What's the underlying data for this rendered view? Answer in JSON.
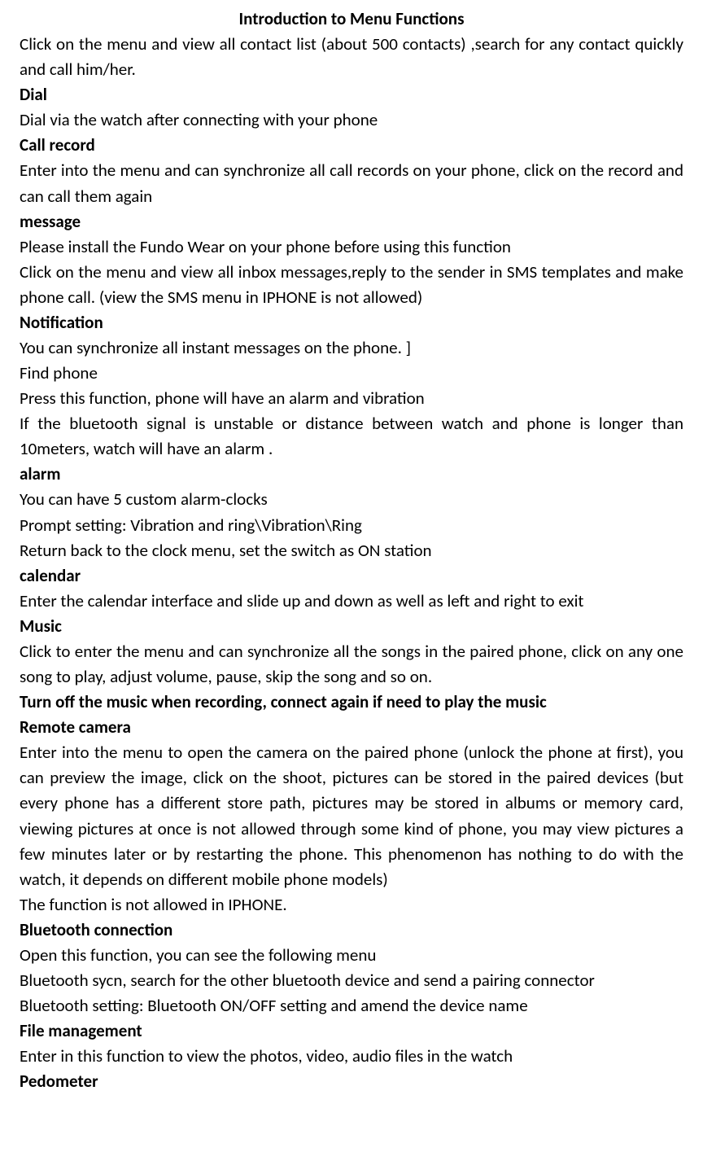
{
  "title": "Introduction to Menu Functions",
  "intro": "Click on the menu and view all contact list (about 500 contacts) ,search for any contact quickly and call him/her.",
  "sections": {
    "dial": {
      "heading": "Dial",
      "body": "Dial via the watch after connecting with your phone"
    },
    "call_record": {
      "heading": "Call record",
      "body": "Enter into the menu and can synchronize all call records on your phone, click on the record and can call them again"
    },
    "message": {
      "heading": "message",
      "body1": "Please install the Fundo Wear on your phone before using this function",
      "body2": "Click on the menu and view all inbox messages,reply to the sender in SMS templates and make phone call. (view the SMS menu in IPHONE is not allowed)"
    },
    "notification": {
      "heading": "Notification",
      "body1": "You can synchronize all instant messages on the phone. ]",
      "body2": "Find phone",
      "body3": "Press this function, phone will have an alarm and vibration",
      "body4": "If the bluetooth signal is unstable or distance between watch and phone is longer than 10meters, watch will have an alarm ."
    },
    "alarm": {
      "heading": "alarm",
      "body1": "You can have 5 custom alarm-clocks",
      "body2": "Prompt setting: Vibration and ring\\Vibration\\Ring",
      "body3": "Return back to the clock menu, set the switch as ON station"
    },
    "calendar": {
      "heading": "calendar",
      "body": "Enter the calendar interface and slide up and down as well as left and right to exit"
    },
    "music": {
      "heading": "Music",
      "body": "Click to enter the menu and can synchronize all the songs in the paired phone, click on any one song to play, adjust volume, pause, skip the song and so on.",
      "warning": "Turn off the music when recording, connect again if need to play the music"
    },
    "remote_camera": {
      "heading": "Remote camera",
      "body1": "Enter into the menu to open the camera on the paired phone (unlock the phone at first), you can preview the image, click on the shoot, pictures can be stored in the paired devices (but every phone has a different store path, pictures may be stored in albums or memory card,    viewing pictures at once is not allowed through some kind of phone, you may view pictures a few minutes later or by restarting the phone. This phenomenon has nothing to do with the watch, it depends on different mobile phone models)",
      "body2": "The function is not allowed in IPHONE."
    },
    "bluetooth": {
      "heading": "Bluetooth connection",
      "body1": "Open this function, you can see the following menu",
      "body2": "Bluetooth sycn, search for the other bluetooth device and send a pairing connector",
      "body3": "Bluetooth setting: Bluetooth ON/OFF setting and amend the device name"
    },
    "file_management": {
      "heading": "File management",
      "body": "Enter in this function to view the photos, video, audio files in the watch"
    },
    "pedometer": {
      "heading": "Pedometer"
    }
  }
}
